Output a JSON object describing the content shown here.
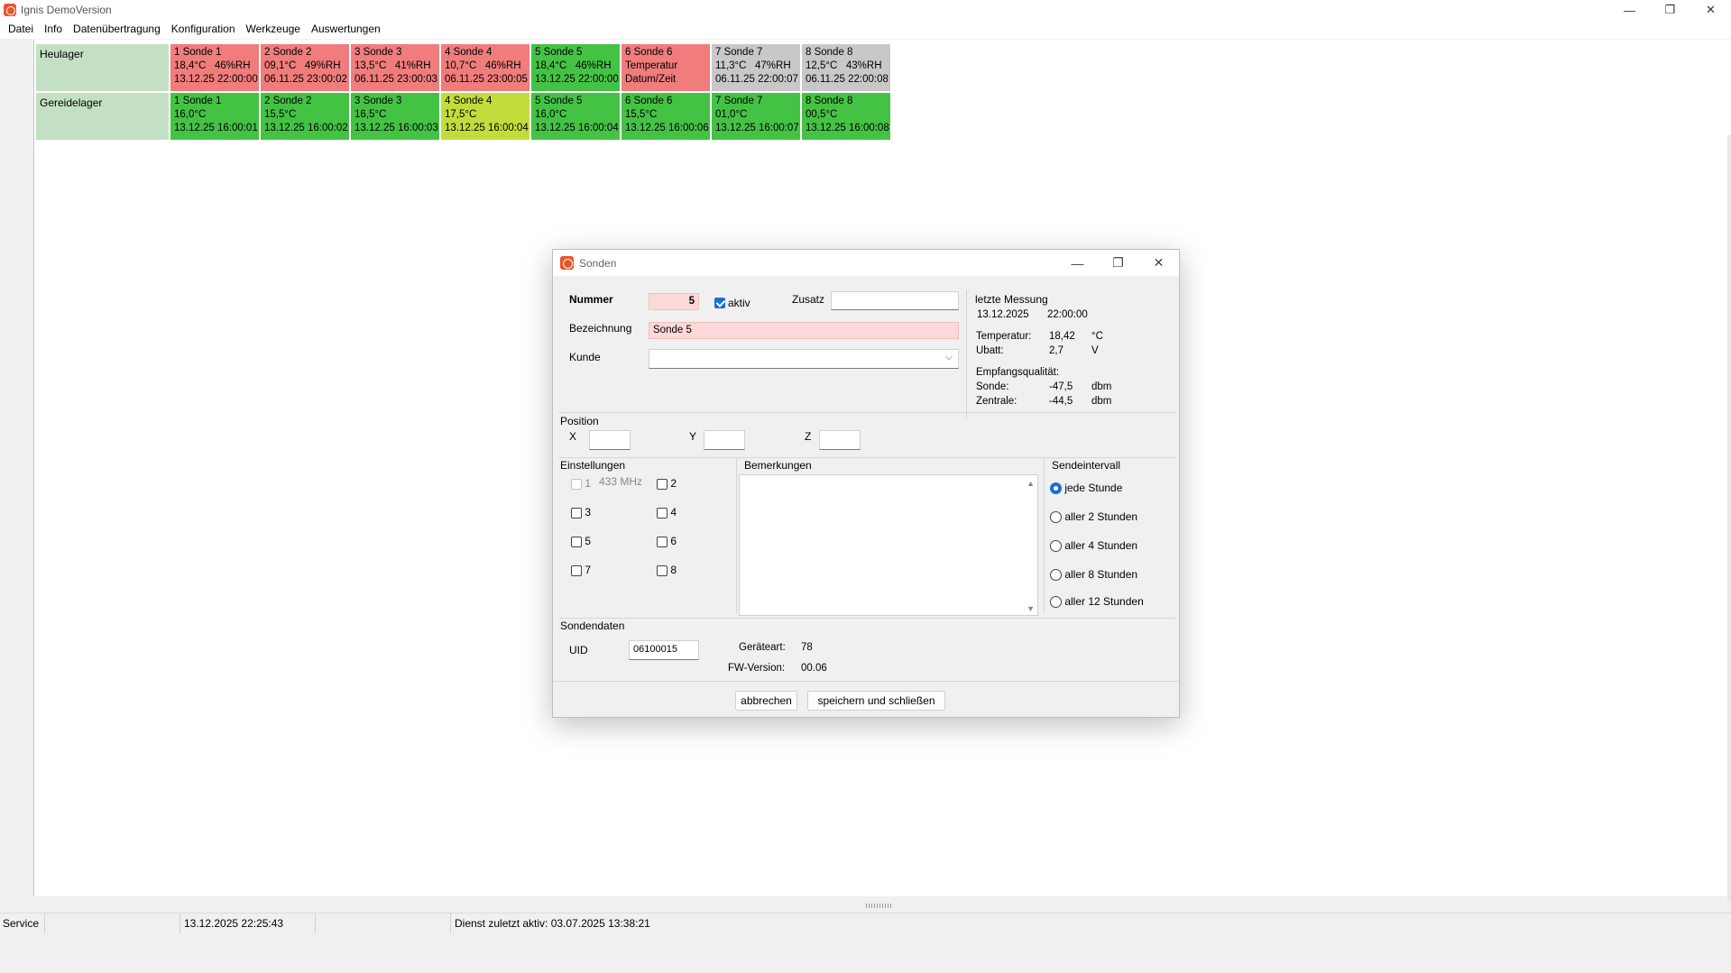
{
  "window": {
    "title": "Ignis  DemoVersion",
    "controls": [
      "—",
      "❐",
      "✕"
    ]
  },
  "menu": [
    "Datei",
    "Info",
    "Datenübertragung",
    "Konfiguration",
    "Werkzeuge",
    "Auswertungen"
  ],
  "locations": [
    {
      "name": "Heulager",
      "sondes": [
        {
          "l1": "1 Sonde 1",
          "l2": "18,4°C   46%RH",
          "l3": "13.12.25 22:00:00",
          "color": "red"
        },
        {
          "l1": "2 Sonde 2",
          "l2": "09,1°C   49%RH",
          "l3": "06.11.25 23:00:02",
          "color": "red"
        },
        {
          "l1": "3 Sonde 3",
          "l2": "13,5°C   41%RH",
          "l3": "06.11.25 23:00:03",
          "color": "red"
        },
        {
          "l1": "4 Sonde 4",
          "l2": "10,7°C   46%RH",
          "l3": "06.11.25 23:00:05",
          "color": "red"
        },
        {
          "l1": "5 Sonde 5",
          "l2": "18,4°C   46%RH",
          "l3": "13.12.25 22:00:00",
          "color": "green"
        },
        {
          "l1": "6 Sonde 6",
          "l2": "Temperatur",
          "l3": "Datum/Zeit",
          "color": "red"
        },
        {
          "l1": "7 Sonde 7",
          "l2": "11,3°C   47%RH",
          "l3": "06.11.25 22:00:07",
          "color": "grey"
        },
        {
          "l1": "8 Sonde 8",
          "l2": "12,5°C   43%RH",
          "l3": "06.11.25 22:00:08",
          "color": "grey"
        }
      ]
    },
    {
      "name": "Gereidelager",
      "sondes": [
        {
          "l1": "1 Sonde 1",
          "l2": "16,0°C",
          "l3": "13.12.25 16:00:01",
          "color": "green"
        },
        {
          "l1": "2 Sonde 2",
          "l2": "15,5°C",
          "l3": "13.12.25 16:00:02",
          "color": "green"
        },
        {
          "l1": "3 Sonde 3",
          "l2": "16,5°C",
          "l3": "13.12.25 16:00:03",
          "color": "green"
        },
        {
          "l1": "4 Sonde 4",
          "l2": "17,5°C",
          "l3": "13.12.25 16:00:04",
          "color": "yellow"
        },
        {
          "l1": "5 Sonde 5",
          "l2": "16,0°C",
          "l3": "13.12.25 16:00:04",
          "color": "green"
        },
        {
          "l1": "6 Sonde 6",
          "l2": "15,5°C",
          "l3": "13.12.25 16:00:06",
          "color": "green"
        },
        {
          "l1": "7 Sonde 7",
          "l2": "01,0°C",
          "l3": "13.12.25 16:00:07",
          "color": "green"
        },
        {
          "l1": "8 Sonde 8",
          "l2": "00,5°C",
          "l3": "13.12.25 16:00:08",
          "color": "green"
        }
      ]
    }
  ],
  "colors": {
    "red": "#f07c7c",
    "green": "#44c244",
    "yellow": "#c2dc3c",
    "grey": "#c8c8c8",
    "location": "#c4e0c4"
  },
  "dialog": {
    "title": "Sonden",
    "nummer_label": "Nummer",
    "nummer_value": "5",
    "aktiv_label": "aktiv",
    "zusatz_label": "Zusatz",
    "zusatz_value": "",
    "bezeichnung_label": "Bezeichnung",
    "bezeichnung_value": "Sonde 5",
    "kunde_label": "Kunde",
    "kunde_value": "",
    "letzte": {
      "title": "letzte Messung",
      "date": "13.12.2025",
      "time": "22:00:00",
      "temp_label": "Temperatur:",
      "temp_value": "18,42",
      "temp_unit": "°C",
      "ubatt_label": "Ubatt:",
      "ubatt_value": "2,7",
      "ubatt_unit": "V",
      "empfang_label": "Empfangsqualität:",
      "sonde_label": "Sonde:",
      "sonde_value": "-47,5",
      "sonde_unit": "dbm",
      "zentrale_label": "Zentrale:",
      "zentrale_value": "-44,5",
      "zentrale_unit": "dbm"
    },
    "position": {
      "title": "Position",
      "x_label": "X",
      "y_label": "Y",
      "z_label": "Z",
      "x_value": "",
      "y_value": "",
      "z_value": ""
    },
    "einstellungen": {
      "title": "Einstellungen",
      "freq_label": "433 MHz",
      "checks": [
        "1",
        "2",
        "3",
        "4",
        "5",
        "6",
        "7",
        "8"
      ]
    },
    "bemerkungen_title": "Bemerkungen",
    "sendeintervall": {
      "title": "Sendeintervall",
      "options": [
        "jede Stunde",
        "aller 2 Stunden",
        "aller 4 Stunden",
        "aller 8 Stunden",
        "aller 12 Stunden"
      ],
      "selected": "jede Stunde"
    },
    "sondendaten": {
      "title": "Sondendaten",
      "uid_label": "UID",
      "uid_value": "06100015",
      "geraeteart_label": "Geräteart:",
      "geraeteart_value": "78",
      "fw_label": "FW-Version:",
      "fw_value": "00.06"
    },
    "cancel_label": "abbrechen",
    "save_label": "speichern und schließen"
  },
  "status": {
    "mode": "Service",
    "datetime": "13.12.2025 22:25:43",
    "service_info": "Dienst zuletzt aktiv: 03.07.2025 13:38:21"
  }
}
